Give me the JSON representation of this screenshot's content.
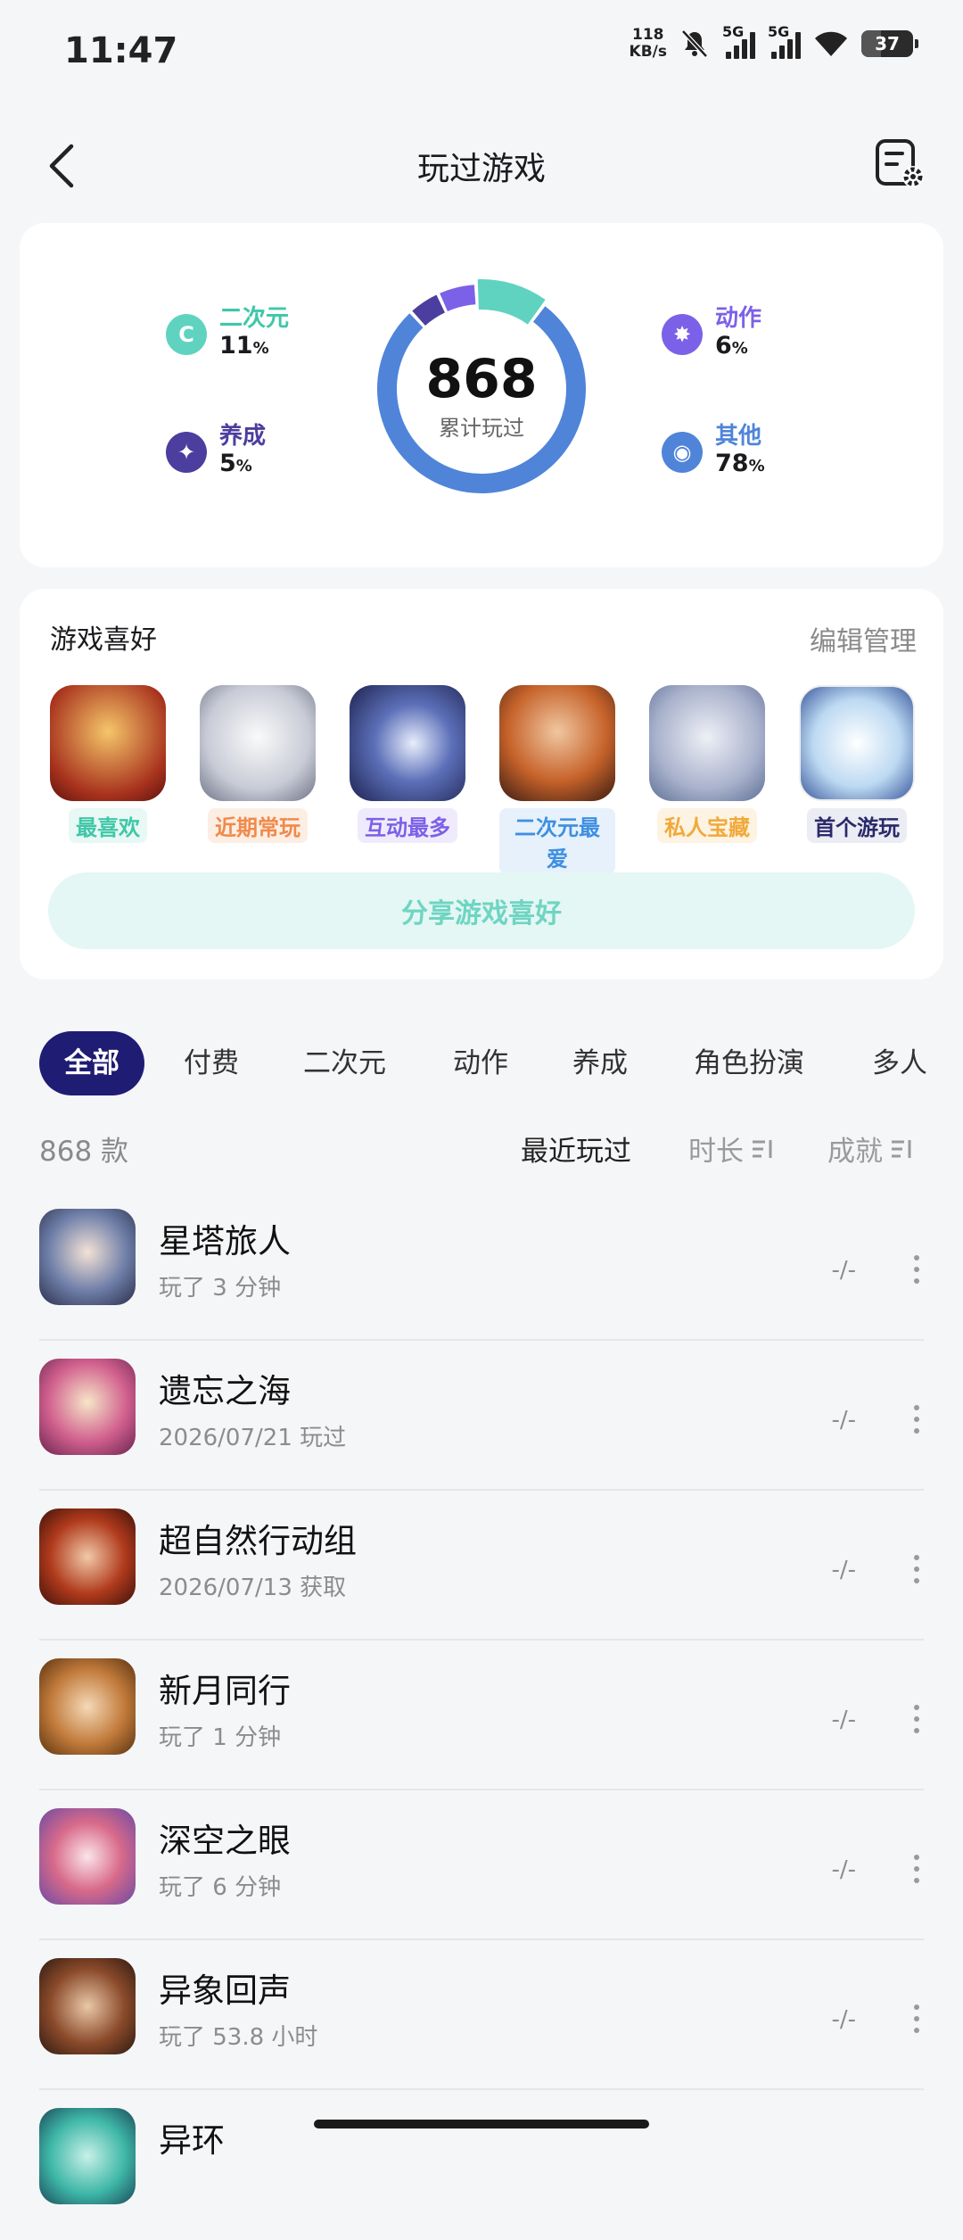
{
  "status": {
    "time": "11:47",
    "speed_value": "118",
    "speed_unit": "KB/s",
    "net1": "5G",
    "net2": "5G",
    "battery": "37"
  },
  "header": {
    "title": "玩过游戏"
  },
  "stats": {
    "total": "868",
    "total_label": "累计玩过",
    "categories": [
      {
        "label": "二次元",
        "pct": "11",
        "color": "#5fd3c0",
        "icon": "c-icon"
      },
      {
        "label": "养成",
        "pct": "5",
        "color": "#4b3e9e",
        "icon": "cultivate-icon"
      },
      {
        "label": "动作",
        "pct": "6",
        "color": "#7b61e8",
        "icon": "action-icon"
      },
      {
        "label": "其他",
        "pct": "78",
        "color": "#4f84d9",
        "icon": "gamepad-icon"
      }
    ],
    "pct_unit": "%"
  },
  "favorites": {
    "title": "游戏喜好",
    "manage": "编辑管理",
    "items": [
      {
        "tag": "最喜欢",
        "color": "#3fc7a8",
        "bg": "#e8f8f4"
      },
      {
        "tag": "近期常玩",
        "color": "#f08a4b",
        "bg": "#fdeee4"
      },
      {
        "tag": "互动最多",
        "color": "#7b61e8",
        "bg": "#efebfd"
      },
      {
        "tag": "二次元最爱",
        "color": "#3f8fe0",
        "bg": "#e6f1fc"
      },
      {
        "tag": "私人宝藏",
        "color": "#f1a93b",
        "bg": "#fdf3e2"
      },
      {
        "tag": "首个游玩",
        "color": "#2a2a6a",
        "bg": "#ececf5"
      }
    ],
    "share": "分享游戏喜好"
  },
  "tabs": [
    "全部",
    "付费",
    "二次元",
    "动作",
    "养成",
    "角色扮演",
    "多人"
  ],
  "list_meta": {
    "count": "868 款",
    "sort_recent": "最近玩过",
    "sort_duration": "时长",
    "sort_achievement": "成就"
  },
  "games": [
    {
      "name": "星塔旅人",
      "sub": "玩了 3 分钟",
      "ach": "-/-"
    },
    {
      "name": "遗忘之海",
      "sub": "2026/07/21 玩过",
      "ach": "-/-"
    },
    {
      "name": "超自然行动组",
      "sub": "2026/07/13 获取",
      "ach": "-/-"
    },
    {
      "name": "新月同行",
      "sub": "玩了 1 分钟",
      "ach": "-/-"
    },
    {
      "name": "深空之眼",
      "sub": "玩了 6 分钟",
      "ach": "-/-"
    },
    {
      "name": "异象回声",
      "sub": "玩了 53.8 小时",
      "ach": "-/-"
    },
    {
      "name": "异环",
      "sub": "",
      "ach": ""
    }
  ]
}
